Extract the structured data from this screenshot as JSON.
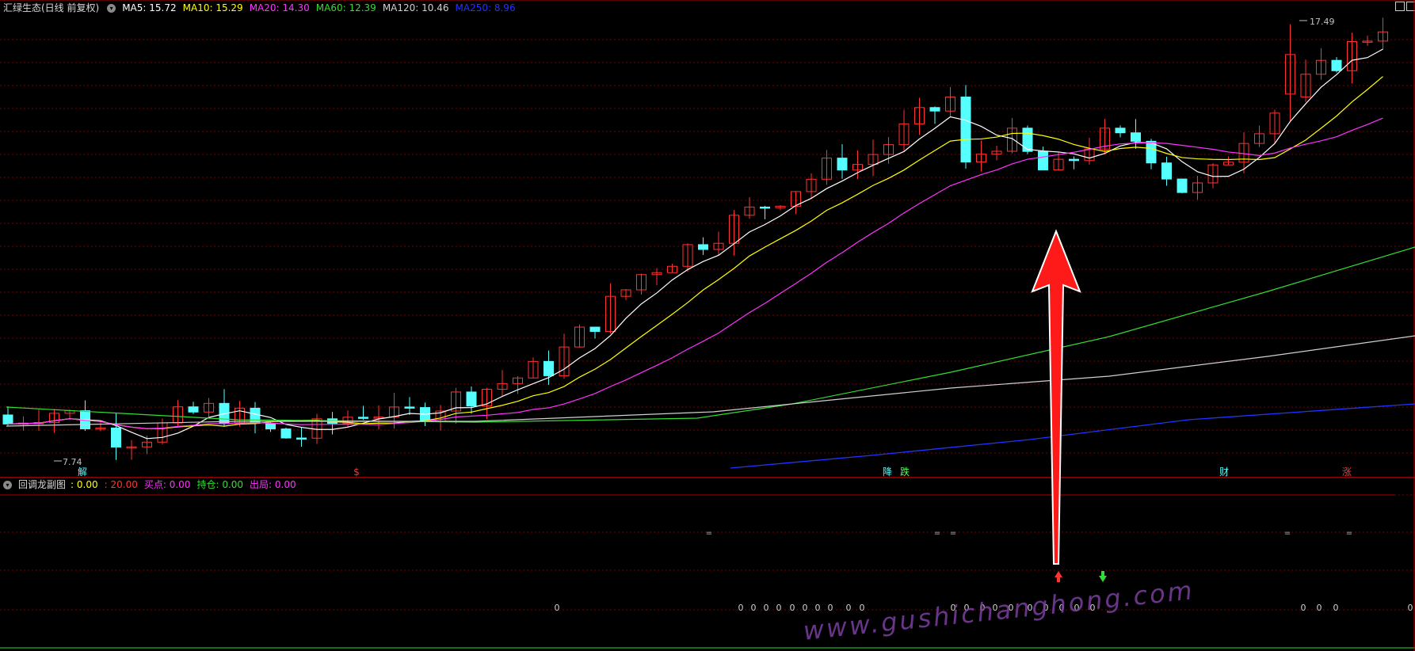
{
  "main": {
    "title": "汇绿生态(日线 前复权)",
    "ma": [
      {
        "label": "MA5:",
        "value": "15.72",
        "color": "#ffffff"
      },
      {
        "label": "MA10:",
        "value": "15.29",
        "color": "#ffff00"
      },
      {
        "label": "MA20:",
        "value": "14.30",
        "color": "#ff33ff"
      },
      {
        "label": "MA60:",
        "value": "12.39",
        "color": "#33dd33"
      },
      {
        "label": "MA120:",
        "value": "10.46",
        "color": "#d0d0d0"
      },
      {
        "label": "MA250:",
        "value": "8.96",
        "color": "#2233ff"
      }
    ],
    "high_label": "17.49",
    "low_label": "7.74",
    "signals": [
      {
        "text": "解",
        "color": "#55ffff"
      },
      {
        "text": "$",
        "color": "#ff3333"
      },
      {
        "text": "降",
        "color": "#55ffff"
      },
      {
        "text": "跌",
        "color": "#55ff55"
      },
      {
        "text": "财",
        "color": "#55ffff"
      },
      {
        "text": "涨",
        "color": "#ff3333"
      }
    ]
  },
  "sub": {
    "title": "回调龙副图",
    "items": [
      {
        "label": ":",
        "value": "0.00",
        "color": "#ffff00"
      },
      {
        "label": ":",
        "value": "20.00",
        "color": "#ff3333"
      },
      {
        "label": "买点:",
        "value": "0.00",
        "color": "#ff33ff"
      },
      {
        "label": "持仓:",
        "value": "0.00",
        "color": "#33dd33"
      },
      {
        "label": "出局:",
        "value": "0.00",
        "color": "#ff33ff"
      }
    ],
    "eq_mark": "=",
    "zero_mark": "0"
  },
  "watermark": "www.gushichanghong.com",
  "colors": {
    "up": "#ff3333",
    "down": "#55ffff",
    "grid": "#7a0000",
    "border": "#b00000"
  }
}
